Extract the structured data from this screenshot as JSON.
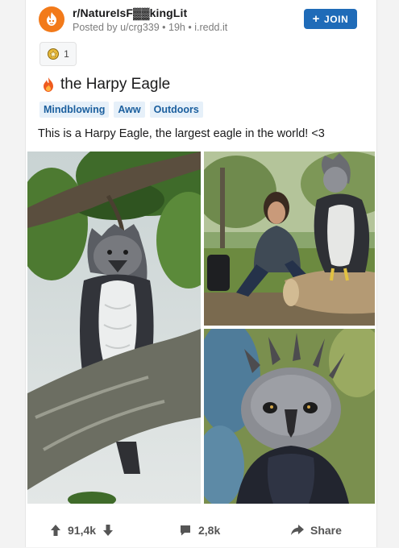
{
  "post": {
    "subreddit": "r/NatureIsF▓▓kingLit",
    "meta": "Posted by u/crg339 • 19h • i.redd.it",
    "join_label": "JOIN",
    "award_count": "1",
    "title": "the Harpy Eagle",
    "flairs": [
      "Mindblowing",
      "Aww",
      "Outdoors"
    ],
    "body": "This is a Harpy Eagle, the largest eagle in the world! <3"
  },
  "footer": {
    "votes": "91,4k",
    "comments": "2,8k",
    "share_label": "Share"
  },
  "colors": {
    "subreddit_icon": "#f27a1a",
    "join_button": "#1f6bb8",
    "flair_bg": "#e6f0f9",
    "flair_text": "#1b5f9e"
  },
  "icons": {
    "subreddit": "flame-avatar-icon",
    "award": "award-medal-icon",
    "title_emoji": "fire-icon",
    "upvote": "arrow-up-icon",
    "downvote": "arrow-down-icon",
    "comment": "comment-bubble-icon",
    "share": "share-arrow-icon"
  }
}
